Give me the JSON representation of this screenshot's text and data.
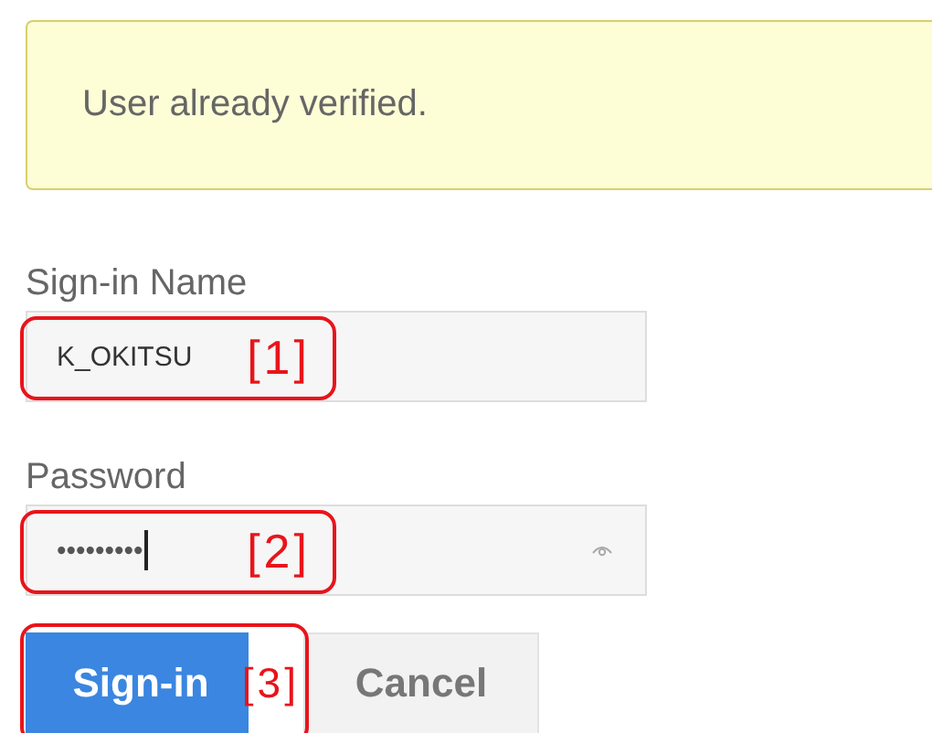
{
  "alert": {
    "message": "User already verified."
  },
  "fields": [
    {
      "kind": "text",
      "label": "Sign-in Name",
      "value": "K_OKITSU",
      "annotation": "[1]",
      "focused": false
    },
    {
      "kind": "password",
      "label": "Password",
      "value": "•••••••••",
      "annotation": "[2]",
      "focused": true
    }
  ],
  "buttons": [
    {
      "label": "Sign-in",
      "primary": true,
      "annotation": "[3]"
    },
    {
      "label": "Cancel",
      "primary": false
    }
  ]
}
